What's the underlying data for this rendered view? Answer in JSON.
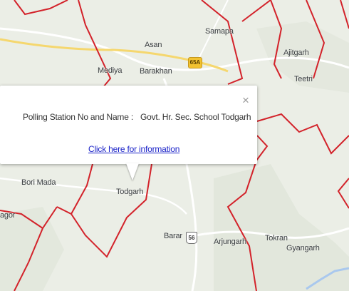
{
  "map": {
    "base_color": "#ebeee6",
    "boundary_color": "#d3222a",
    "road_color": "#ffffff",
    "highway_color": "#f5d76e",
    "places": [
      {
        "id": "asan",
        "name": "Asan"
      },
      {
        "id": "samapa",
        "name": "Samapa"
      },
      {
        "id": "ajitgarh",
        "name": "Ajitgarh"
      },
      {
        "id": "mediya",
        "name": "Mediya"
      },
      {
        "id": "barakhan",
        "name": "Barakhan"
      },
      {
        "id": "teetri",
        "name": "Teetri"
      },
      {
        "id": "bori-mada",
        "name": "Bori Mada"
      },
      {
        "id": "todgarh",
        "name": "Todgarh"
      },
      {
        "id": "agor",
        "name": "agor"
      },
      {
        "id": "barar",
        "name": "Barar"
      },
      {
        "id": "arjungarh",
        "name": "Arjungarh"
      },
      {
        "id": "tokran",
        "name": "Tokran"
      },
      {
        "id": "gyangarh",
        "name": "Gyangarh"
      }
    ],
    "route_shields": [
      {
        "id": "route-65a",
        "label": "65A",
        "color": "#f2c230"
      },
      {
        "id": "route-56",
        "label": "56",
        "color": "#ffffff"
      }
    ]
  },
  "info_window": {
    "close_symbol": "×",
    "label": "Polling Station No and Name :",
    "value": "Govt. Hr. Sec. School Todgarh",
    "link_text": "Click here for information"
  }
}
